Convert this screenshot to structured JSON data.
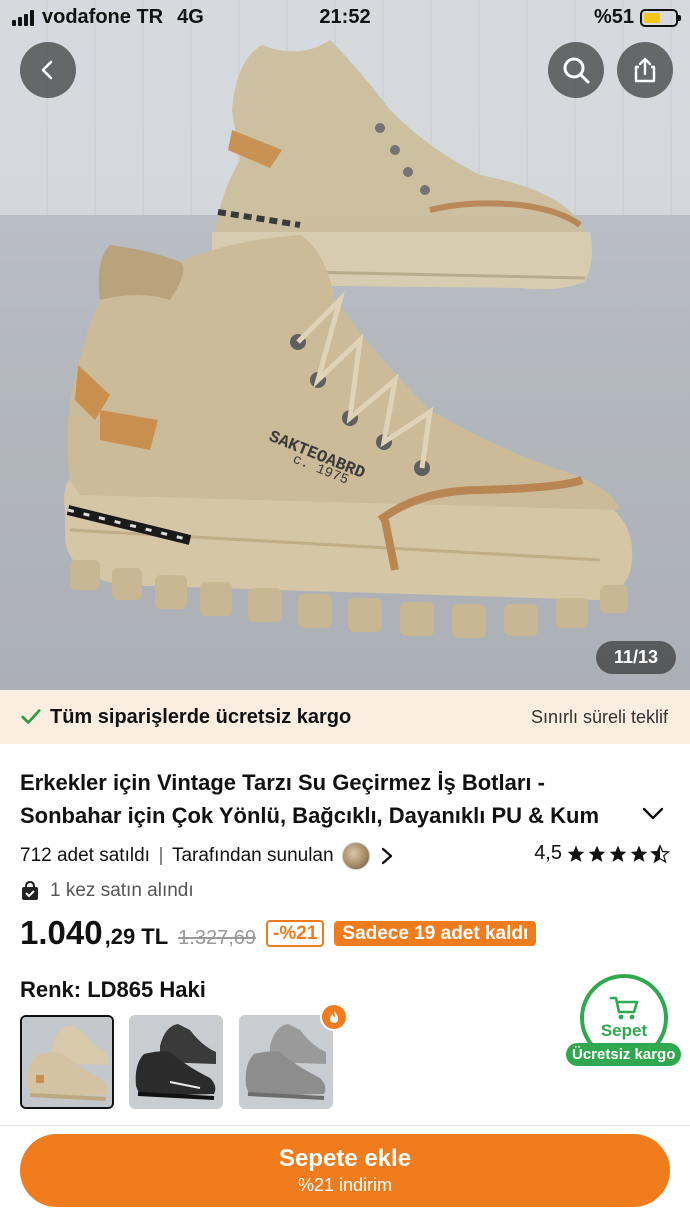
{
  "status_bar": {
    "carrier": "vodafone TR",
    "network": "4G",
    "time": "21:52",
    "battery": "%51"
  },
  "gallery": {
    "counter": "11/13",
    "brand_print_1": "SAKTEOABRD",
    "brand_print_2": "c. 1975"
  },
  "banner": {
    "text": "Tüm siparişlerde ücretsiz kargo",
    "right": "Sınırlı süreli teklif"
  },
  "product": {
    "title_line1": "Erkekler için Vintage Tarzı Su Geçirmez İş Botları -",
    "title_line2": "Sonbahar için Çok Yönlü, Bağcıklı, Dayanıklı PU & Kum",
    "sold": "712 adet satıldı",
    "offered_by": "Tarafından sunulan",
    "rating": "4,5",
    "rating_value": 4.5,
    "bought": "1 kez satın alındı",
    "price_main": "1.040",
    "price_decimal": ",29 TL",
    "price_old": "1.327,69",
    "discount": "-%21",
    "stock": "Sadece 19 adet kaldı",
    "color_label": "Renk: LD865 Haki"
  },
  "swatches": [
    {
      "name": "Haki",
      "color": "#d4c3a2",
      "selected": true
    },
    {
      "name": "Siyah",
      "color": "#2b2b2b",
      "selected": false
    },
    {
      "name": "Gri",
      "color": "#8d8d8d",
      "selected": false
    }
  ],
  "cart": {
    "label": "Sepet",
    "pill": "Ücretsiz kargo"
  },
  "add_button": {
    "label": "Sepete ekle",
    "sublabel": "%21 indirim"
  },
  "colors": {
    "accent": "#f07c1e",
    "green": "#2fa84f",
    "banner_bg": "#fbeee1"
  }
}
